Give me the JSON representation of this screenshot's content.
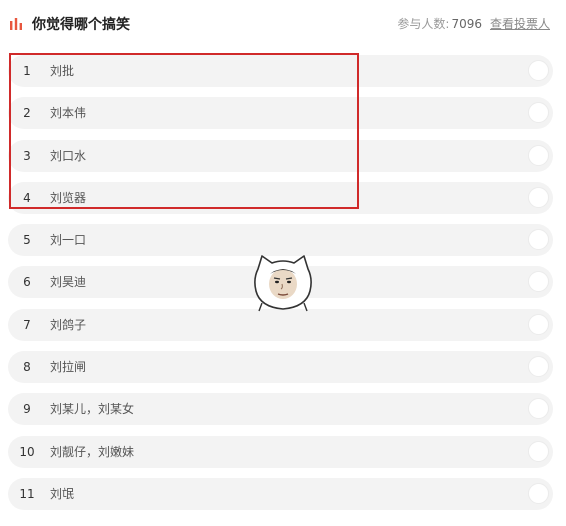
{
  "header": {
    "icon": "bar-chart-icon",
    "title": "你觉得哪个搞笑",
    "participants_label": "参与人数:",
    "participants_count": "7096",
    "view_voters_link": "查看投票人"
  },
  "options": [
    {
      "num": "1",
      "label": "刘批"
    },
    {
      "num": "2",
      "label": "刘本伟"
    },
    {
      "num": "3",
      "label": "刘口水"
    },
    {
      "num": "4",
      "label": "刘览器"
    },
    {
      "num": "5",
      "label": "刘一口"
    },
    {
      "num": "6",
      "label": "刘昊迪"
    },
    {
      "num": "7",
      "label": "刘鸽子"
    },
    {
      "num": "8",
      "label": "刘拉闸"
    },
    {
      "num": "9",
      "label": "刘某儿，刘某女"
    },
    {
      "num": "10",
      "label": "刘靓仔，刘嫩妹"
    },
    {
      "num": "11",
      "label": "刘氓"
    }
  ],
  "colors": {
    "accent_icon": "#e8573f",
    "highlight_border": "#d02a2a",
    "option_bg": "#f3f3f3"
  },
  "sticker": {
    "icon": "cartoon-face-sticker"
  }
}
